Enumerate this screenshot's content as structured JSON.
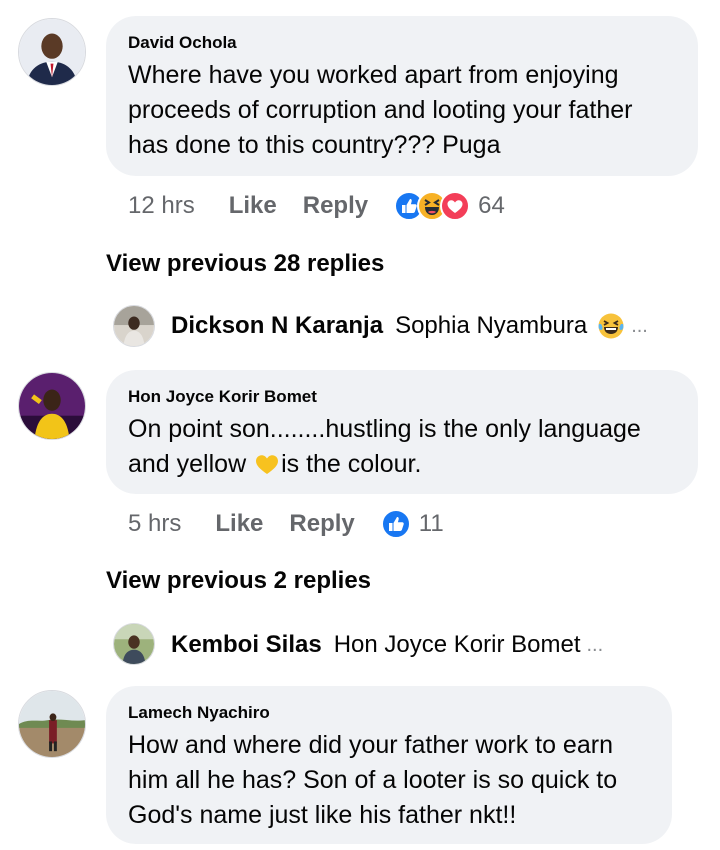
{
  "comments": [
    {
      "author": "David Ochola",
      "text_lines": [
        "Where have you worked apart from enjoying",
        "proceeds of corruption and looting your father",
        "has done to this country??? Puga"
      ],
      "time": "12 hrs",
      "like_label": "Like",
      "reply_label": "Reply",
      "reactions": [
        "like-icon",
        "haha-icon",
        "love-icon"
      ],
      "reaction_count": "64",
      "view_previous": "View previous 28 replies",
      "reply": {
        "author": "Dickson N Karanja",
        "text": "Sophia Nyambura",
        "emoji": "tears-of-joy-icon",
        "ellipsis": "..."
      }
    },
    {
      "author": "Hon Joyce Korir Bomet",
      "text_line1": "On point son........hustling is the only language",
      "text_line2_before": "and yellow ",
      "text_line2_emoji": "yellow-heart-icon",
      "text_line2_after": "is the colour.",
      "time": "5 hrs",
      "like_label": "Like",
      "reply_label": "Reply",
      "reactions": [
        "like-icon"
      ],
      "reaction_count": "11",
      "view_previous": "View previous 2 replies",
      "reply": {
        "author": "Kemboi Silas",
        "text": "Hon Joyce Korir Bomet",
        "ellipsis": "..."
      }
    },
    {
      "author": "Lamech Nyachiro",
      "text_lines": [
        "How and where did your father work to earn",
        "him all he has? Son of a looter is so quick to",
        "God's name just like his father nkt!!"
      ]
    }
  ],
  "colors": {
    "bubble": "#f0f2f5",
    "meta_text": "#65676b",
    "like_blue": "#1877f2",
    "love_red": "#f33e58",
    "haha_yellow": "#f7b125"
  }
}
